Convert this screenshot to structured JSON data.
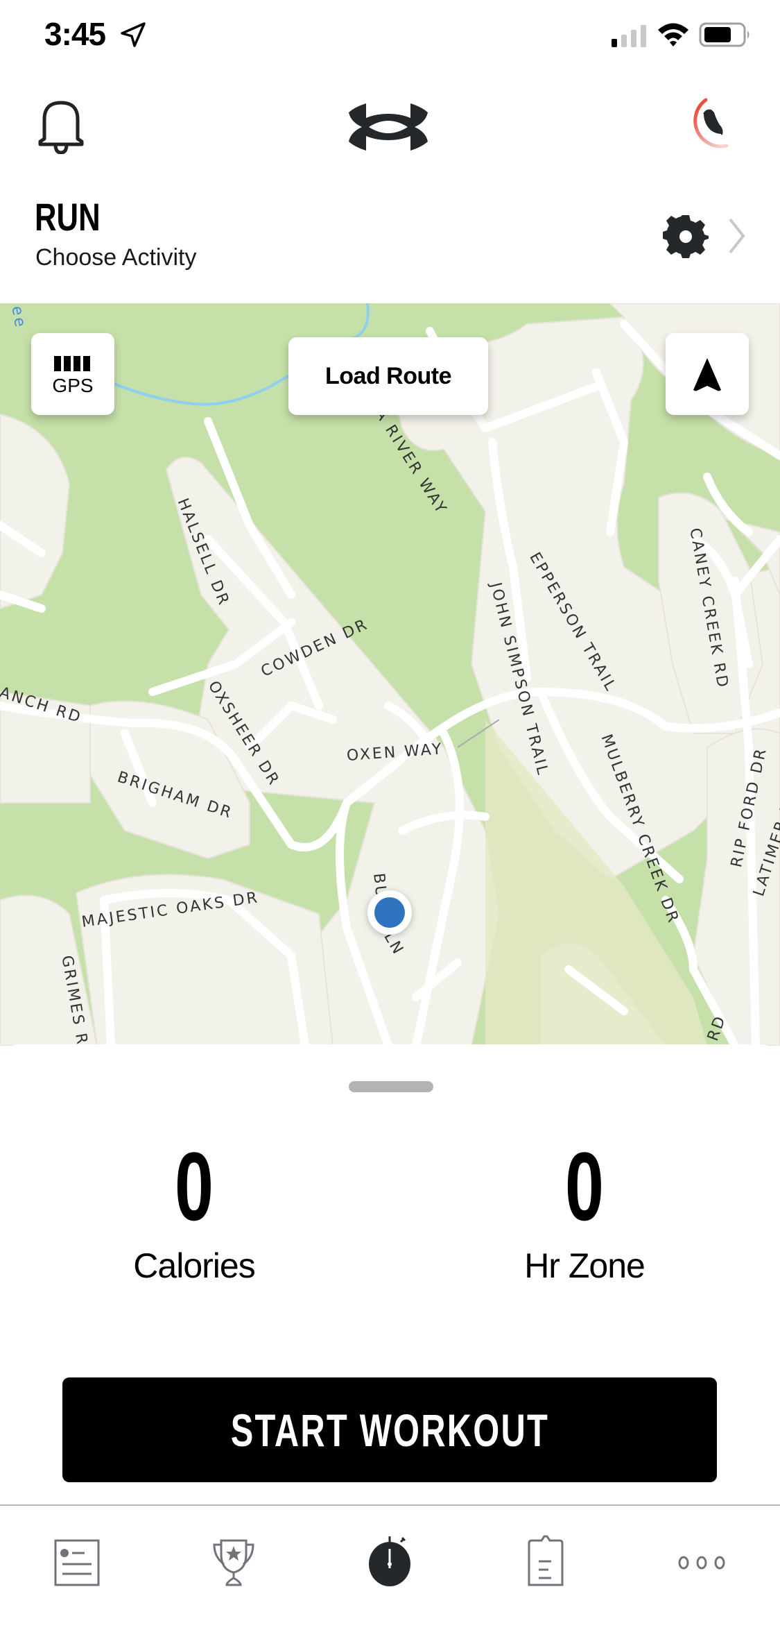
{
  "status_bar": {
    "time": "3:45",
    "location_icon": "location-arrow-icon",
    "signal_icon": "cellular-signal-icon",
    "wifi_icon": "wifi-icon",
    "battery_icon": "battery-icon"
  },
  "top_nav": {
    "notifications_icon": "bell-icon",
    "logo": "under-armour-logo",
    "profile_icon": "shoe-progress-ring-icon"
  },
  "activity": {
    "title": "RUN",
    "subtitle": "Choose Activity",
    "settings_icon": "gear-icon",
    "chevron_icon": "chevron-right-icon"
  },
  "map": {
    "gps_label": "GPS",
    "gps_icon": "gps-signal-bars-icon",
    "load_route_label": "Load Route",
    "recenter_icon": "navigation-arrow-icon",
    "streets": [
      "HALSELL DR",
      "DINA RIVER WAY",
      "EPPERSON TRAIL",
      "JOHN SIMPSON TRAIL",
      "CANEY CREEK RD",
      "COWDEN DR",
      "ANCH RD",
      "OXSHEER DR",
      "OXEN WAY",
      "BRIGHAM DR",
      "MULBERRY CREEK DR",
      "RIP FORD DR",
      "LATIMER DR",
      "MAJESTIC OAKS DR",
      "GRIMES RAN",
      "BU",
      "LN",
      "RD",
      "ee"
    ],
    "accent_water": "#8fd0ef",
    "accent_park": "#c5e0a8",
    "location_dot_color": "#2f72bd"
  },
  "metrics": {
    "calories": {
      "value": "0",
      "label": "Calories"
    },
    "hr_zone": {
      "value": "0",
      "label": "Hr Zone"
    }
  },
  "start_button": {
    "label": "START WORKOUT"
  },
  "tab_bar": {
    "items": [
      {
        "name": "feed",
        "icon": "feed-card-icon",
        "active": false
      },
      {
        "name": "challenges",
        "icon": "trophy-icon",
        "active": false
      },
      {
        "name": "record",
        "icon": "stopwatch-icon",
        "active": true
      },
      {
        "name": "training-plans",
        "icon": "clipboard-icon",
        "active": false
      },
      {
        "name": "more",
        "icon": "more-dots-icon",
        "active": false
      }
    ]
  }
}
